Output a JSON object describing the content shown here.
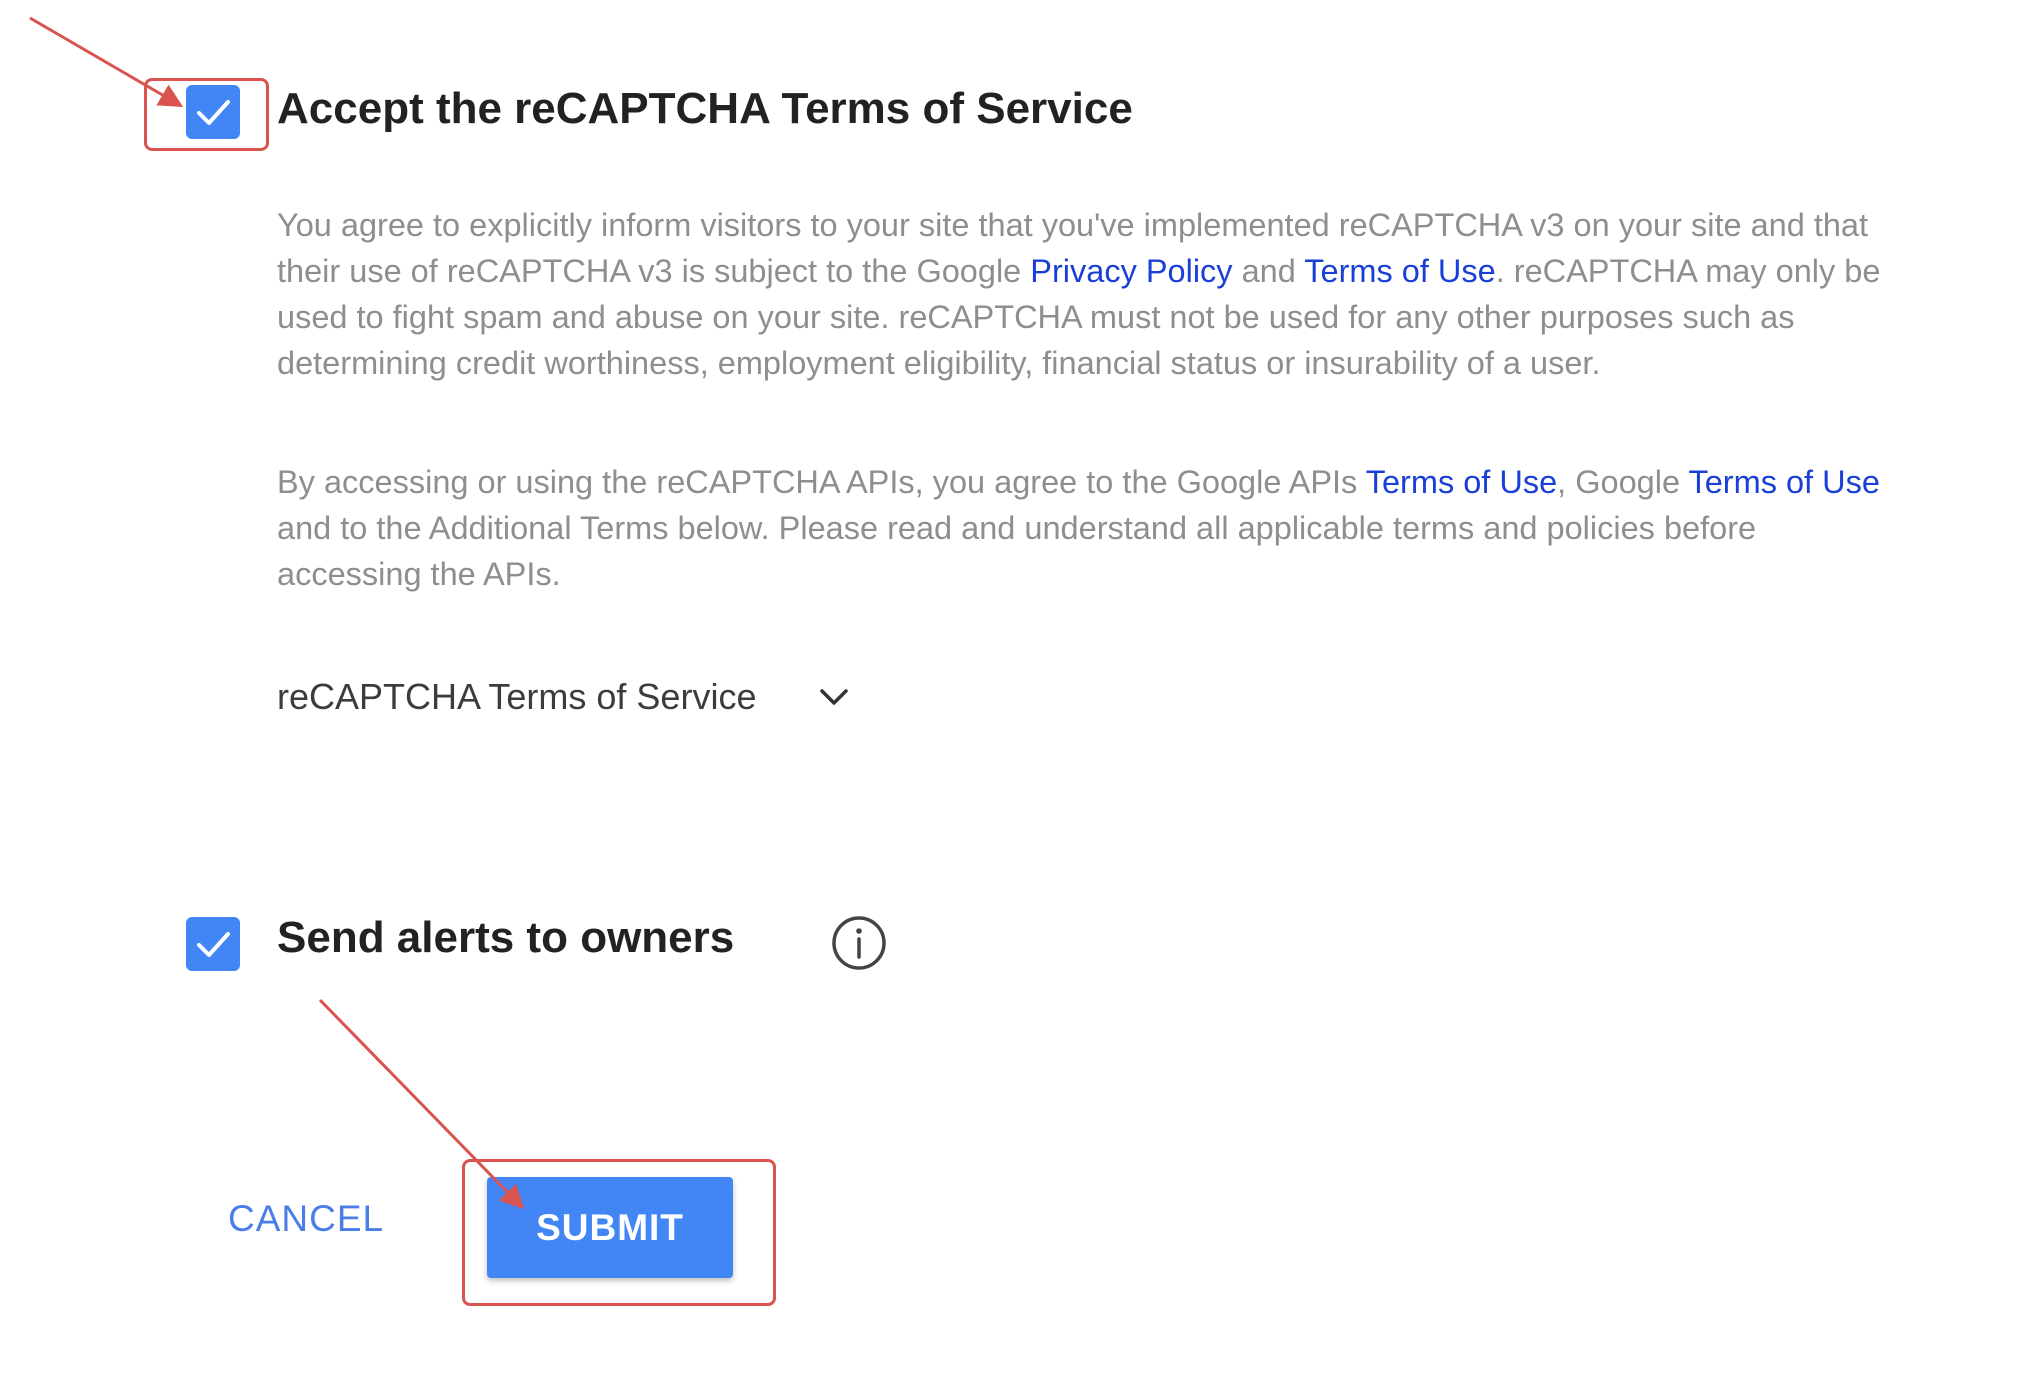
{
  "colors": {
    "accent": "#4285f4",
    "link": "#1a3fd6",
    "annotation": "#d9534f"
  },
  "terms": {
    "checkbox_checked": true,
    "heading": "Accept the reCAPTCHA Terms of Service",
    "paragraph1": {
      "part1": "You agree to explicitly inform visitors to your site that you've implemented reCAPTCHA v3 on your site and that their use of reCAPTCHA v3 is subject to the Google ",
      "link_privacy": "Privacy Policy",
      "part2": " and ",
      "link_terms": "Terms of Use",
      "part3": ". reCAPTCHA may only be used to fight spam and abuse on your site. reCAPTCHA must not be used for any other purposes such as determining credit worthiness, employment eligibility, financial status or insurability of a user."
    },
    "paragraph2": {
      "part1": "By accessing or using the reCAPTCHA APIs, you agree to the Google APIs ",
      "link_api_terms": "Terms of Use",
      "part2": ", Google ",
      "link_google_terms": "Terms of Use",
      "part3": " and to the Additional Terms below. Please read and understand all applicable terms and policies before accessing the APIs."
    },
    "expander_label": "reCAPTCHA Terms of Service",
    "expander_icon": "chevron-down-icon"
  },
  "alerts": {
    "checkbox_checked": true,
    "label": "Send alerts to owners",
    "info_icon": "info-icon"
  },
  "actions": {
    "cancel_label": "CANCEL",
    "submit_label": "SUBMIT"
  }
}
